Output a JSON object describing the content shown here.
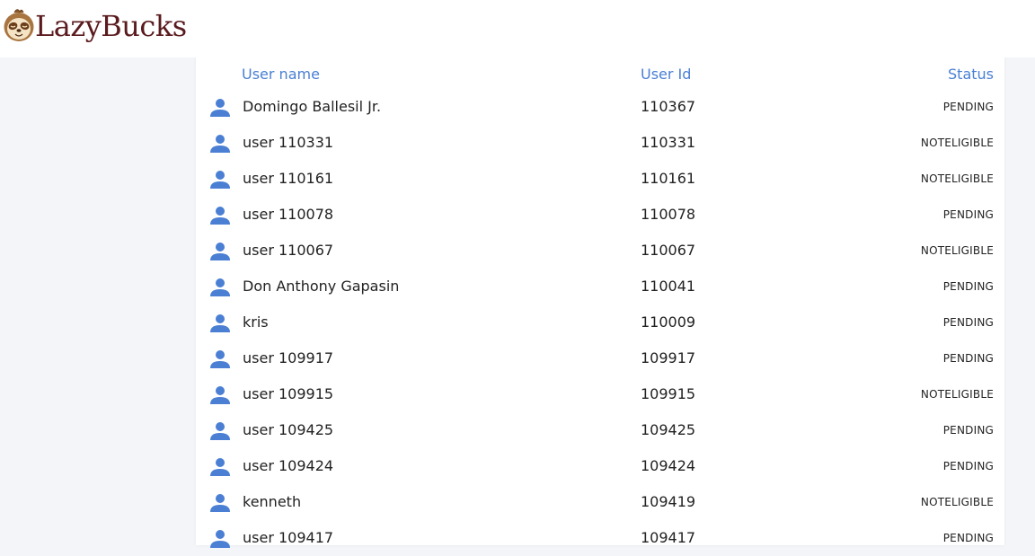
{
  "brand": {
    "name": "LazyBucks",
    "color": "#5a1a1e"
  },
  "table": {
    "columns": {
      "name": "User name",
      "id": "User Id",
      "status": "Status"
    },
    "accent": "#4a7fd4",
    "rows": [
      {
        "name": "Domingo Ballesil Jr.",
        "id": "110367",
        "status": "PENDING",
        "icon": "user-icon"
      },
      {
        "name": "user 110331",
        "id": "110331",
        "status": "NOTELIGIBLE",
        "icon": "user-icon"
      },
      {
        "name": "user 110161",
        "id": "110161",
        "status": "NOTELIGIBLE",
        "icon": "user-icon"
      },
      {
        "name": "user 110078",
        "id": "110078",
        "status": "PENDING",
        "icon": "user-icon"
      },
      {
        "name": "user 110067",
        "id": "110067",
        "status": "NOTELIGIBLE",
        "icon": "user-icon"
      },
      {
        "name": "Don Anthony Gapasin",
        "id": "110041",
        "status": "PENDING",
        "icon": "user-icon"
      },
      {
        "name": "kris",
        "id": "110009",
        "status": "PENDING",
        "icon": "user-icon"
      },
      {
        "name": "user 109917",
        "id": "109917",
        "status": "PENDING",
        "icon": "user-icon"
      },
      {
        "name": "user 109915",
        "id": "109915",
        "status": "NOTELIGIBLE",
        "icon": "user-icon"
      },
      {
        "name": "user 109425",
        "id": "109425",
        "status": "PENDING",
        "icon": "user-icon"
      },
      {
        "name": "user 109424",
        "id": "109424",
        "status": "PENDING",
        "icon": "user-icon"
      },
      {
        "name": "kenneth",
        "id": "109419",
        "status": "NOTELIGIBLE",
        "icon": "user-icon"
      },
      {
        "name": "user 109417",
        "id": "109417",
        "status": "PENDING",
        "icon": "user-icon"
      }
    ]
  }
}
